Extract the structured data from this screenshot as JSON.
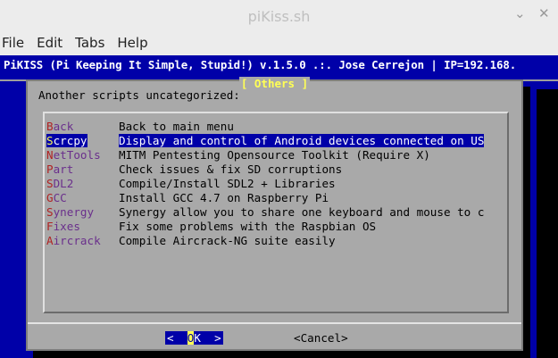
{
  "window": {
    "title": "piKiss.sh",
    "controls": [
      "chevron-down-icon",
      "close-icon"
    ]
  },
  "menubar": [
    "File",
    "Edit",
    "Tabs",
    "Help"
  ],
  "header": {
    "text": "PiKISS (Pi Keeping It Simple, Stupid!) v.1.5.0 .:. Jose Cerrejon | IP=192.168."
  },
  "dialog": {
    "title": "[ Others ]",
    "prompt": "Another scripts uncategorized:",
    "items": [
      {
        "tag": "Back",
        "desc": "Back to main menu",
        "selected": false
      },
      {
        "tag": "Scrcpy",
        "desc": "Display and control of Android devices connected on US",
        "selected": true
      },
      {
        "tag": "NetTools",
        "desc": "MITM Pentesting Opensource Toolkit (Require X)",
        "selected": false
      },
      {
        "tag": "Part",
        "desc": "Check issues & fix SD corruptions",
        "selected": false
      },
      {
        "tag": "SDL2",
        "desc": "Compile/Install SDL2 + Libraries",
        "selected": false
      },
      {
        "tag": "GCC",
        "desc": "Install GCC 4.7 on Raspberry Pi",
        "selected": false
      },
      {
        "tag": "Synergy",
        "desc": "Synergy allow you to share one keyboard and mouse to c",
        "selected": false
      },
      {
        "tag": "Fixes",
        "desc": "Fix some problems with the Raspbian OS",
        "selected": false
      },
      {
        "tag": "Aircrack",
        "desc": "Compile Aircrack-NG suite easily",
        "selected": false
      }
    ],
    "ok_button": {
      "left": "<",
      "hot": "O",
      "label": "K",
      "right": ">"
    },
    "cancel_button": "<Cancel>"
  },
  "colors": {
    "terminal_bg": "#0000a8",
    "dialog_bg": "#a9a9a9",
    "highlight": "#ffff55",
    "hotkey": "#b02222"
  }
}
